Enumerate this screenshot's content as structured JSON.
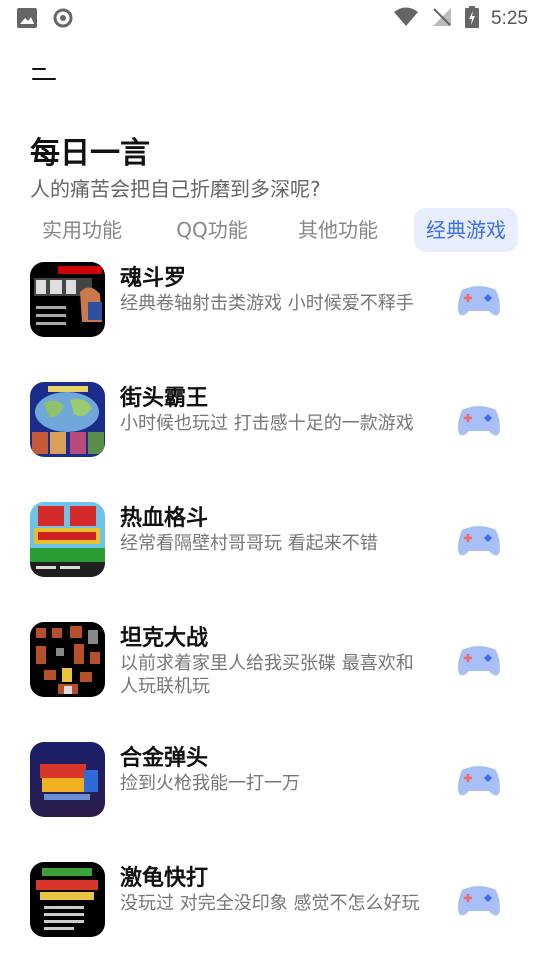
{
  "status_bar": {
    "time": "5:25"
  },
  "header": {
    "title": "每日一言",
    "quote": "人的痛苦会把自己折磨到多深呢?"
  },
  "tabs": [
    {
      "label": "实用功能",
      "active": false
    },
    {
      "label": "QQ功能",
      "active": false
    },
    {
      "label": "其他功能",
      "active": false
    },
    {
      "label": "经典游戏",
      "active": true
    }
  ],
  "games": [
    {
      "name": "魂斗罗",
      "desc": "经典卷轴射击类游戏 小时候爱不释手",
      "thumb": "contra",
      "icon": "gamepad-icon"
    },
    {
      "name": "街头霸王",
      "desc": "小时候也玩过 打击感十足的一款游戏",
      "thumb": "street-fighter",
      "icon": "gamepad-icon"
    },
    {
      "name": "热血格斗",
      "desc": "经常看隔壁村哥哥玩 看起来不错",
      "thumb": "nekketsu",
      "icon": "gamepad-icon"
    },
    {
      "name": "坦克大战",
      "desc": "以前求着家里人给我买张碟 最喜欢和人玩联机玩",
      "thumb": "battle-city",
      "icon": "gamepad-icon"
    },
    {
      "name": "合金弹头",
      "desc": "捡到火枪我能一打一万",
      "thumb": "metal-slug",
      "icon": "gamepad-icon"
    },
    {
      "name": "激龟快打",
      "desc": "没玩过 对完全没印象 感觉不怎么好玩",
      "thumb": "tmnt",
      "icon": "gamepad-icon"
    }
  ],
  "colors": {
    "accent": "#3d6ef1",
    "tab_active_bg": "#e8eefd",
    "muted": "#777777"
  }
}
